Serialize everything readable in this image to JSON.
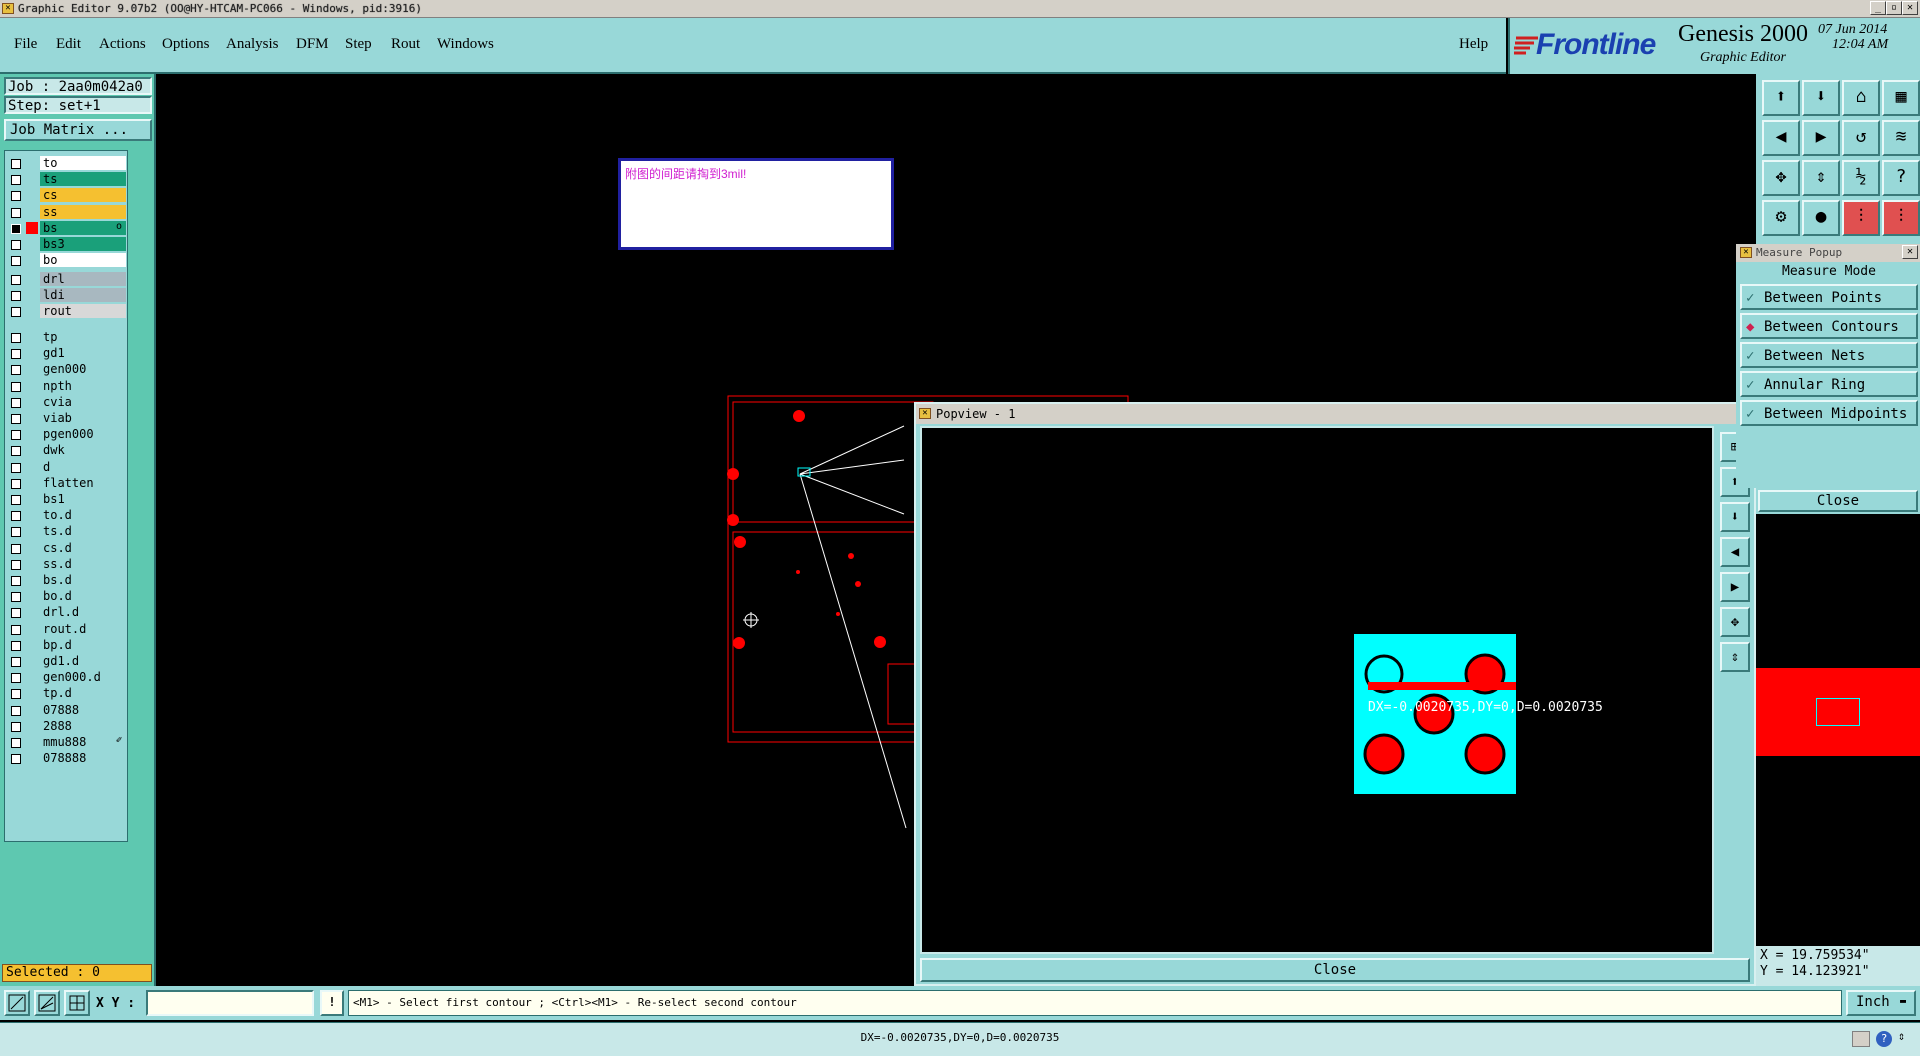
{
  "window": {
    "title": "Graphic Editor 9.07b2 (OO@HY-HTCAM-PC066 - Windows, pid:3916)",
    "controls": [
      "_",
      "▫",
      "✕"
    ]
  },
  "menu": {
    "items": [
      "File",
      "Edit",
      "Actions",
      "Options",
      "Analysis",
      "DFM",
      "Step",
      "Rout",
      "Windows"
    ],
    "help": "Help"
  },
  "brand": {
    "logo": "Frontline",
    "product": "Genesis 2000",
    "subtitle": "Graphic Editor",
    "date": "07 Jun 2014",
    "time": "12:04 AM"
  },
  "job": {
    "job_label": "Job : 2aa0m042a0",
    "step_label": "Step: set+1",
    "matrix_button": "Job Matrix ..."
  },
  "layers": {
    "group1": [
      {
        "name": "to",
        "color": "#ffffff",
        "checked": false
      },
      {
        "name": "ts",
        "color": "#1aa07a",
        "checked": false
      },
      {
        "name": "cs",
        "color": "#f5c030",
        "checked": false
      },
      {
        "name": "ss",
        "color": "#f5c030",
        "checked": false
      },
      {
        "name": "bs",
        "color": "#1aa07a",
        "checked": true,
        "mark": "o"
      },
      {
        "name": "bs3",
        "color": "#1aa07a",
        "checked": false
      },
      {
        "name": "bo",
        "color": "#ffffff",
        "checked": false
      }
    ],
    "group2": [
      {
        "name": "drl",
        "color": "#a8b8c0",
        "checked": false
      },
      {
        "name": "ldi",
        "color": "#a8b8c0",
        "checked": false
      },
      {
        "name": "rout",
        "color": "#d8d8d8",
        "checked": false
      }
    ],
    "group3": [
      {
        "name": "tp"
      },
      {
        "name": "gd1"
      },
      {
        "name": "gen000"
      },
      {
        "name": "npth"
      },
      {
        "name": "cvia"
      },
      {
        "name": "viab"
      },
      {
        "name": "pgen000"
      },
      {
        "name": "dwk"
      },
      {
        "name": "d"
      },
      {
        "name": "flatten"
      },
      {
        "name": "bs1"
      },
      {
        "name": "to.d"
      },
      {
        "name": "ts.d"
      },
      {
        "name": "cs.d"
      },
      {
        "name": "ss.d"
      },
      {
        "name": "bs.d"
      },
      {
        "name": "bo.d"
      },
      {
        "name": "drl.d"
      },
      {
        "name": "rout.d"
      },
      {
        "name": "bp.d"
      },
      {
        "name": "gd1.d"
      },
      {
        "name": "gen000.d"
      },
      {
        "name": "tp.d"
      },
      {
        "name": "07888"
      },
      {
        "name": "2888"
      },
      {
        "name": "mmu888",
        "mark": "✐"
      },
      {
        "name": "078888"
      }
    ],
    "group3_color": "#98d8d8"
  },
  "selected": "Selected : 0",
  "note": "附图的间距请掏到3mil!",
  "popview": {
    "title": "Popview - 1",
    "measure_text": "DX=-0.0020735,DY=0,D=0.0020735",
    "close": "Close"
  },
  "measure_popup": {
    "title": "Measure Popup",
    "mode_label": "Measure Mode",
    "options": [
      {
        "label": "Between Points",
        "selected": false
      },
      {
        "label": "Between Contours",
        "selected": true
      },
      {
        "label": "Between Nets",
        "selected": false
      },
      {
        "label": "Annular Ring",
        "selected": false
      },
      {
        "label": "Between Midpoints",
        "selected": false
      }
    ],
    "close": "Close"
  },
  "coords": {
    "x": "X = 19.759534\"",
    "y": "Y = 14.123921\""
  },
  "bottom": {
    "xy_label": "X Y :",
    "xy_value": "",
    "hint": "<M1> - Select first contour ; <Ctrl><M1> - Re-select second contour",
    "units": "Inch"
  },
  "status": "DX=-0.0020735,DY=0,D=0.0020735",
  "colors": {
    "teal_bg": "#98d8d8",
    "panel_green": "#5ec8b0",
    "board_red": "#ff0000",
    "pad_cyan": "#00ffff",
    "note_text": "#d020d0"
  }
}
